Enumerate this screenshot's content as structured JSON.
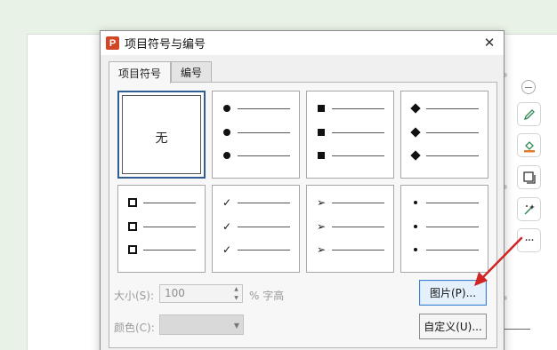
{
  "dialog": {
    "title": "项目符号与编号",
    "app_icon_letter": "P",
    "close_glyph": "✕",
    "tabs": [
      {
        "label": "项目符号",
        "active": true
      },
      {
        "label": "编号",
        "active": false
      }
    ],
    "bullet_cells": [
      {
        "kind": "none",
        "label": "无",
        "selected": true
      },
      {
        "kind": "filled-circle"
      },
      {
        "kind": "filled-square"
      },
      {
        "kind": "filled-diamond"
      },
      {
        "kind": "hollow-square"
      },
      {
        "kind": "checkmark",
        "glyph": "✓"
      },
      {
        "kind": "arrowhead",
        "glyph": "➢"
      },
      {
        "kind": "small-dot"
      }
    ],
    "size_label": "大小(S):",
    "size_value": "100",
    "size_unit": "% 字高",
    "color_label": "颜色(C):",
    "picture_button": "图片(P)...",
    "custom_button": "自定义(U)..."
  },
  "side_toolbar": {
    "icons": [
      "minus-icon",
      "pen-icon",
      "fill-icon",
      "frame-icon",
      "magic-wand-icon",
      "more-icon"
    ],
    "more_label": "···"
  },
  "colors": {
    "background": "#e9f2e7",
    "annotation_arrow": "#d22424",
    "app_icon": "#d24625",
    "focus_border": "#3b7fd4"
  }
}
